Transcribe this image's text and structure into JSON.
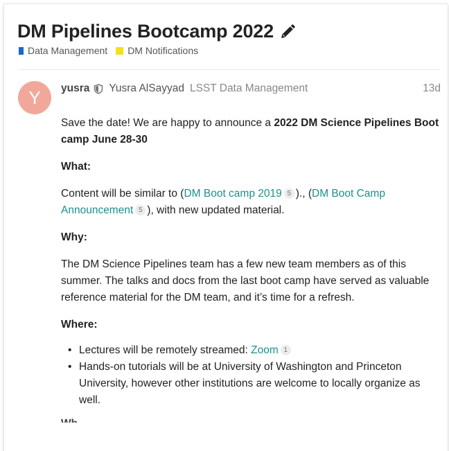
{
  "topic": {
    "title": "DM Pipelines Bootcamp 2022",
    "edit_icon": "pencil-icon",
    "categories": [
      {
        "label": "Data Management",
        "color": "#1a67c9"
      },
      {
        "label": "DM Notifications",
        "color": "#f2e21a"
      }
    ]
  },
  "post": {
    "avatar": {
      "letter": "Y",
      "color": "#f1a89a"
    },
    "username": "yusra",
    "moderator_icon": "shield-icon",
    "full_name": "Yusra AlSayyad",
    "group": "LSST Data Management",
    "age": "13d",
    "intro_plain": "Save the date! We are happy to announce a ",
    "intro_bold": "2022 DM Science Pipelines Boot camp June 28-30",
    "what_heading": "What:",
    "content_before": "Content will be similar to (",
    "link1_text": "DM Boot camp 2019",
    "link1_clicks": "5",
    "content_mid": ")., (",
    "link2_text": "DM Boot Camp Announcement",
    "link2_clicks": "5",
    "content_after": "), with new updated material.",
    "why_heading": "Why:",
    "why_text": "The DM Science Pipelines team has a few new team members as of this summer. The talks and docs from the last boot camp have served as valuable reference material for the DM team, and it’s time for a refresh.",
    "where_heading": "Where:",
    "bullet1_before": "Lectures will be remotely streamed: ",
    "bullet1_link": "Zoom",
    "bullet1_clicks": "1",
    "bullet2": "Hands-on tutorials will be at University of Washington and Princeton University, however other institutions are welcome to locally organize as well.",
    "next_heading_partial": "Wh"
  },
  "colors": {
    "link": "#1b8f8f",
    "text": "#222222",
    "muted": "#888888"
  }
}
